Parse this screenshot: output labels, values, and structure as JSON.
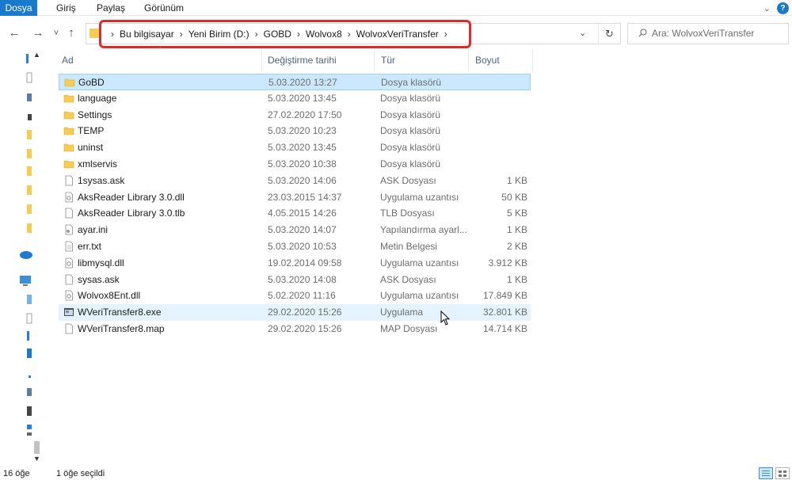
{
  "ribbon": {
    "tabs": [
      "Dosya",
      "Giriş",
      "Paylaş",
      "Görünüm"
    ],
    "help_label": "?"
  },
  "nav": {
    "back": "←",
    "forward": "→",
    "recent": "˅",
    "up": "↑"
  },
  "address": {
    "breadcrumbs": [
      "Bu bilgisayar",
      "Yeni Birim (D:)",
      "GOBD",
      "Wolvox8",
      "WolvoxVeriTransfer"
    ],
    "separator": "›"
  },
  "search": {
    "placeholder": "Ara: WolvoxVeriTransfer"
  },
  "columns": {
    "name": "Ad",
    "date": "Değiştirme tarihi",
    "type": "Tür",
    "size": "Boyut"
  },
  "files": [
    {
      "name": "GoBD",
      "date": "5.03.2020 13:27",
      "type": "Dosya klasörü",
      "size": "",
      "icon": "folder-icon"
    },
    {
      "name": "language",
      "date": "5.03.2020 13:45",
      "type": "Dosya klasörü",
      "size": "",
      "icon": "folder-icon"
    },
    {
      "name": "Settings",
      "date": "27.02.2020 17:50",
      "type": "Dosya klasörü",
      "size": "",
      "icon": "folder-icon"
    },
    {
      "name": "TEMP",
      "date": "5.03.2020 10:23",
      "type": "Dosya klasörü",
      "size": "",
      "icon": "folder-icon"
    },
    {
      "name": "uninst",
      "date": "5.03.2020 13:45",
      "type": "Dosya klasörü",
      "size": "",
      "icon": "folder-icon"
    },
    {
      "name": "xmlservis",
      "date": "5.03.2020 10:38",
      "type": "Dosya klasörü",
      "size": "",
      "icon": "folder-icon"
    },
    {
      "name": "1sysas.ask",
      "date": "5.03.2020 14:06",
      "type": "ASK Dosyası",
      "size": "1 KB",
      "icon": "file-icon"
    },
    {
      "name": "AksReader Library 3.0.dll",
      "date": "23.03.2015 14:37",
      "type": "Uygulama uzantısı",
      "size": "50 KB",
      "icon": "dll-icon"
    },
    {
      "name": "AksReader Library 3.0.tlb",
      "date": "4.05.2015 14:26",
      "type": "TLB Dosyası",
      "size": "5 KB",
      "icon": "file-icon"
    },
    {
      "name": "ayar.ini",
      "date": "5.03.2020 14:07",
      "type": "Yapılandırma ayarl...",
      "size": "1 KB",
      "icon": "ini-icon"
    },
    {
      "name": "err.txt",
      "date": "5.03.2020 10:53",
      "type": "Metin Belgesi",
      "size": "2 KB",
      "icon": "text-file-icon"
    },
    {
      "name": "libmysql.dll",
      "date": "19.02.2014 09:58",
      "type": "Uygulama uzantısı",
      "size": "3.912 KB",
      "icon": "dll-icon"
    },
    {
      "name": "sysas.ask",
      "date": "5.03.2020 14:08",
      "type": "ASK Dosyası",
      "size": "1 KB",
      "icon": "file-icon"
    },
    {
      "name": "Wolvox8Ent.dll",
      "date": "5.02.2020 11:16",
      "type": "Uygulama uzantısı",
      "size": "17.849 KB",
      "icon": "dll-icon"
    },
    {
      "name": "WVeriTransfer8.exe",
      "date": "29.02.2020 15:26",
      "type": "Uygulama",
      "size": "32.801 KB",
      "icon": "exe-icon"
    },
    {
      "name": "WVeriTransfer8.map",
      "date": "29.02.2020 15:26",
      "type": "MAP Dosyası",
      "size": "14.714 KB",
      "icon": "file-icon"
    }
  ],
  "selected_row": 0,
  "hovered_row": 14,
  "status": {
    "item_count": "16 öğe",
    "selected": "1 öğe seçildi"
  },
  "colors": {
    "accent": "#1979ca",
    "selection": "#cce8ff",
    "highlight_box": "#dd2a2a",
    "folder": "#f5cd55"
  }
}
